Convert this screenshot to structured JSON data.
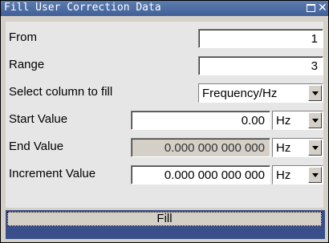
{
  "window": {
    "title": "Fill User Correction Data"
  },
  "form": {
    "from": {
      "label": "From",
      "value": "1"
    },
    "range": {
      "label": "Range",
      "value": "3"
    },
    "column": {
      "label": "Select column to fill",
      "value": "Frequency/Hz"
    },
    "start": {
      "label": "Start Value",
      "value": "0.00",
      "unit": "Hz"
    },
    "end": {
      "label": "End Value",
      "value": "0.000 000 000 000",
      "unit": "Hz"
    },
    "increment": {
      "label": "Increment Value",
      "value": "0.000 000 000 000",
      "unit": "Hz"
    }
  },
  "actions": {
    "fill_label": "Fill"
  },
  "colors": {
    "titlebar": "#4a6aa3",
    "background": "#d4d0c8",
    "fill_bar": "#3a4f8a"
  },
  "icons": [
    "maximize-icon",
    "close-icon",
    "chevron-down-icon"
  ]
}
